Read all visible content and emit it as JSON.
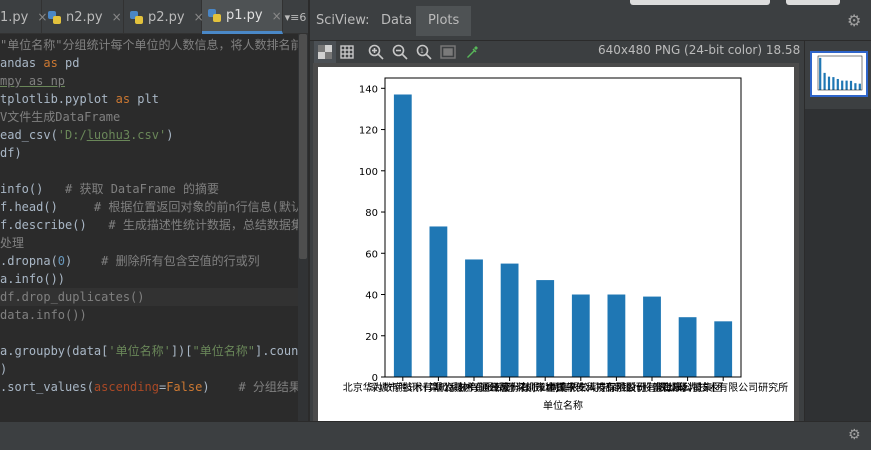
{
  "editor": {
    "tabs": [
      {
        "label": "1.py",
        "active": false
      },
      {
        "label": "n2.py",
        "active": false
      },
      {
        "label": "p2.py",
        "active": false
      },
      {
        "label": "p1.py",
        "active": true
      }
    ],
    "overflow_tabs": "▾≡6",
    "lines": [
      [
        {
          "t": "\"单位名称\"分组统计每个单位的人数信息，将人数排名前10的单",
          "c": "cm"
        }
      ],
      [
        {
          "t": "andas ",
          "c": ""
        },
        {
          "t": "as",
          "c": "kw"
        },
        {
          "t": " pd",
          "c": ""
        }
      ],
      [
        {
          "t": "mpy as np",
          "c": "cm uline"
        }
      ],
      [
        {
          "t": "tplotlib.pyplot ",
          "c": ""
        },
        {
          "t": "as",
          "c": "kw"
        },
        {
          "t": " plt",
          "c": ""
        }
      ],
      [
        {
          "t": "V文件生成DataFrame",
          "c": "cm"
        }
      ],
      [
        {
          "t": "ead_csv(",
          "c": ""
        },
        {
          "t": "'D:/",
          "c": "str"
        },
        {
          "t": "luohu3",
          "c": "str uline"
        },
        {
          "t": ".csv'",
          "c": "str"
        },
        {
          "t": ")",
          "c": ""
        }
      ],
      [
        {
          "t": "df)",
          "c": ""
        }
      ],
      [
        {
          "t": "",
          "c": ""
        }
      ],
      [
        {
          "t": "info()   ",
          "c": ""
        },
        {
          "t": "# 获取 DataFrame 的摘要",
          "c": "cm"
        }
      ],
      [
        {
          "t": "f.head()     ",
          "c": ""
        },
        {
          "t": "# 根据位置返回对象的前n行信息(默认值为5)",
          "c": "cm"
        }
      ],
      [
        {
          "t": "f.describe()   ",
          "c": ""
        },
        {
          "t": "# 生成描述性统计数据，总结数据集分布的",
          "c": "cm"
        }
      ],
      [
        {
          "t": "处理",
          "c": "cm"
        }
      ],
      [
        {
          "t": ".dropna(",
          "c": ""
        },
        {
          "t": "0",
          "c": "num"
        },
        {
          "t": ")    ",
          "c": ""
        },
        {
          "t": "# 删除所有包含空值的行或列",
          "c": "cm"
        }
      ],
      [
        {
          "t": "a.info())",
          "c": ""
        }
      ],
      [
        {
          "t": "df.drop_duplicates()",
          "c": "cm"
        }
      ],
      [
        {
          "t": "data.info())",
          "c": "cm"
        }
      ],
      [
        {
          "t": "",
          "c": ""
        }
      ],
      [
        {
          "t": "a.groupby(data[",
          "c": ""
        },
        {
          "t": "'单位名称'",
          "c": "str"
        },
        {
          "t": "])[",
          "c": ""
        },
        {
          "t": "\"单位名称\"",
          "c": "str"
        },
        {
          "t": "].count()  ",
          "c": ""
        },
        {
          "t": "# 分",
          "c": "cm"
        }
      ],
      [
        {
          "t": ")",
          "c": ""
        }
      ],
      [
        {
          "t": ".sort_values(",
          "c": ""
        },
        {
          "t": "ascending",
          "c": "param"
        },
        {
          "t": "=",
          "c": ""
        },
        {
          "t": "False",
          "c": "kw"
        },
        {
          "t": ")    ",
          "c": ""
        },
        {
          "t": "# 分组结果排序",
          "c": "cm"
        }
      ]
    ]
  },
  "sciview": {
    "title": "SciView:",
    "tabs": [
      {
        "label": "Data",
        "active": false
      },
      {
        "label": "Plots",
        "active": true
      }
    ],
    "image_info": "640x480 PNG (24-bit color) 18.58 KB",
    "toolbar_icons": [
      "checkerboard-icon",
      "grid-icon",
      "zoom-in-icon",
      "zoom-out-icon",
      "actual-size-icon",
      "fit-window-icon",
      "color-picker-icon"
    ]
  },
  "chart_data": {
    "type": "bar",
    "title": "",
    "xlabel": "单位名称",
    "ylabel": "",
    "ylim": [
      0,
      145
    ],
    "yticks": [
      0,
      20,
      40,
      60,
      80,
      100,
      120,
      140
    ],
    "categories": [
      "北京华为数字技术有限公司",
      "深圳市腾讯计算机系统有限公司",
      "华为技术有限公司",
      "中兴通讯股份有限公司",
      "平安科技(深圳)有限公司",
      "深圳市金蝶软件科技有限公司",
      "中国平安人寿保险股份有限公司",
      "招商银行股份有限公司",
      "富士康科技集团",
      "深圳华为技术有限公司研究所"
    ],
    "values": [
      137,
      73,
      57,
      55,
      47,
      40,
      40,
      39,
      29,
      27
    ],
    "bar_color": "#1f77b4",
    "grid": false
  }
}
